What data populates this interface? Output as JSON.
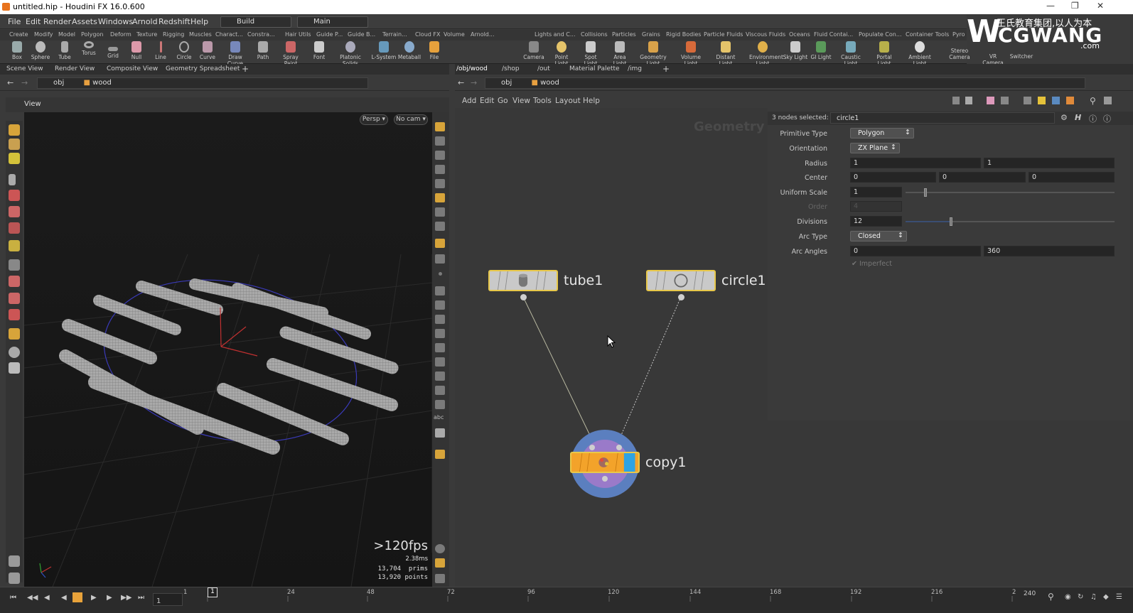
{
  "window": {
    "title": "untitled.hip - Houdini FX 16.0.600"
  },
  "menu": {
    "items": [
      "File",
      "Edit",
      "Render",
      "Assets",
      "Windows",
      "Arnold",
      "Redshift",
      "Help"
    ],
    "desktop_label": "Build",
    "view_label": "Main"
  },
  "shelf_tabs_left": [
    "Create",
    "Modify",
    "Model",
    "Polygon",
    "Deform",
    "Texture",
    "Rigging",
    "Muscles",
    "Charact...",
    "Constra...",
    "Hair Utils",
    "Guide P...",
    "Guide B...",
    "Terrain...",
    "Cloud FX",
    "Volume",
    "Arnold..."
  ],
  "shelf_tabs_right": [
    "Lights and C...",
    "Collisions",
    "Particles",
    "Grains",
    "Rigid Bodies",
    "Particle Fluids",
    "Viscous Fluids",
    "Oceans",
    "Fluid Contai...",
    "Populate Con...",
    "Container Tools",
    "Pyro"
  ],
  "tools_left": [
    "Box",
    "Sphere",
    "Tube",
    "Torus",
    "Grid",
    "Null",
    "Line",
    "Circle",
    "Curve",
    "Draw Curve",
    "Path",
    "Spray Paint",
    "Font",
    "Platonic Solids",
    "L-System",
    "Metaball",
    "File"
  ],
  "tools_right": [
    "Camera",
    "Point Light",
    "Spot Light",
    "Area Light",
    "Geometry Light",
    "Volume Light",
    "Distant Light",
    "Environment Light",
    "Sky Light",
    "GI Light",
    "Caustic Light",
    "Portal Light",
    "Ambient Light",
    "Stereo Camera",
    "VR Camera",
    "Switcher"
  ],
  "watermark": {
    "cn": "王氏教育集团,以人为本",
    "brand": "CGWANG",
    "domain": ".com"
  },
  "left_pane": {
    "tabs": [
      "Scene View",
      "Render View",
      "Composite View",
      "Geometry Spreadsheet"
    ],
    "path": [
      "obj",
      "wood"
    ],
    "header": "View",
    "persp_label": "Persp",
    "cam_label": "No cam"
  },
  "hud": {
    "fps": ">120fps",
    "ms": "2.38ms",
    "prims_count": "13,704",
    "prims_label": "prims",
    "points_count": "13,920",
    "points_label": "points"
  },
  "right_pane": {
    "tabs": [
      "/obj/wood",
      "/shop",
      "/out",
      "Material Palette",
      "/img"
    ],
    "path": [
      "obj",
      "wood"
    ],
    "menu": [
      "Add",
      "Edit",
      "Go",
      "View",
      "Tools",
      "Layout",
      "Help"
    ],
    "context_label": "Geometry"
  },
  "nodes": {
    "tube": "tube1",
    "circle": "circle1",
    "copy": "copy1"
  },
  "params": {
    "selection": "3 nodes selected:",
    "node_field": "circle1",
    "primitive_type": {
      "label": "Primitive Type",
      "value": "Polygon"
    },
    "orientation": {
      "label": "Orientation",
      "value": "ZX Plane"
    },
    "radius": {
      "label": "Radius",
      "x": "1",
      "y": "1"
    },
    "center": {
      "label": "Center",
      "x": "0",
      "y": "0",
      "z": "0"
    },
    "uniform_scale": {
      "label": "Uniform Scale",
      "value": "1"
    },
    "order": {
      "label": "Order",
      "value": "4"
    },
    "divisions": {
      "label": "Divisions",
      "value": "12"
    },
    "arc_type": {
      "label": "Arc Type",
      "value": "Closed"
    },
    "arc_angles": {
      "label": "Arc Angles",
      "start": "0",
      "end": "360"
    },
    "imperfect": {
      "label": "Imperfect"
    }
  },
  "timeline": {
    "start": "1",
    "current": "1",
    "ticks": [
      "24",
      "48",
      "72",
      "96",
      "120",
      "144",
      "168",
      "192",
      "216"
    ],
    "end_frame": "240",
    "end_tick": "2"
  }
}
